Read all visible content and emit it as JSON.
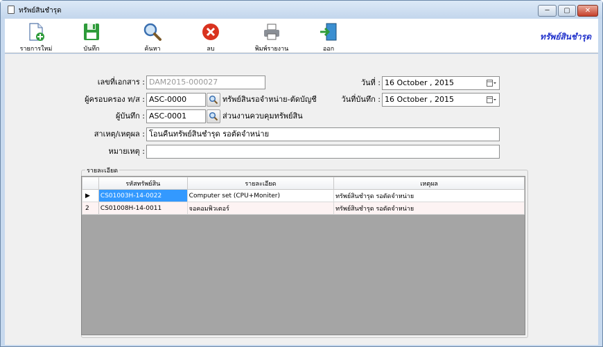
{
  "window": {
    "title": "ทรัพย์สินชำรุด",
    "min_label": "─",
    "max_label": "▢",
    "close_label": "✕"
  },
  "toolbar": {
    "new_label": "รายการใหม่",
    "save_label": "บันทึก",
    "search_label": "ค้นหา",
    "delete_label": "ลบ",
    "print_label": "พิมพ์รายงาน",
    "exit_label": "ออก",
    "brand": "ทรัพย์สินชำรุด"
  },
  "form": {
    "doc_no_label": "เลขที่เอกสาร :",
    "doc_no": "DAM2015-000027",
    "custodian_label": "ผู้ครอบครอง ท/ส :",
    "custodian_code": "ASC-0000",
    "custodian_name": "ทรัพย์สินรอจำหน่าย-ตัดบัญชี",
    "recorder_label": "ผู้บันทึก :",
    "recorder_code": "ASC-0001",
    "recorder_name": "ส่วนงานควบคุมทรัพย์สิน",
    "cause_label": "สาเหตุ/เหตุผล :",
    "cause": "โอนคืนทรัพย์สินชำรุด รอตัดจำหน่าย",
    "remark_label": "หมายเหตุ :",
    "remark": "",
    "date_label": "วันที่ :",
    "date_value": "16   October  , 2015",
    "record_date_label": "วันที่บันทึก :",
    "record_date_value": "16   October  , 2015"
  },
  "details": {
    "group_title": "รายละเอียด",
    "columns": [
      "รหัสทรัพย์สิน",
      "รายละเอียด",
      "เหตุผล"
    ],
    "rows": [
      {
        "marker": "▶",
        "code": "CS01003H-14-0022",
        "detail": "Computer set (CPU+Moniter)",
        "reason": "ทรัพย์สินชำรุด รอตัดจำหน่าย"
      },
      {
        "marker": "2",
        "code": "CS01008H-14-0011",
        "detail": "จอคอมพิวเตอร์",
        "reason": "ทรัพย์สินชำรุด รอตัดจำหน่าย"
      }
    ]
  },
  "icons": {
    "new": "new-document-icon",
    "save": "floppy-disk-icon",
    "search": "magnifier-icon",
    "delete": "red-x-icon",
    "print": "printer-icon",
    "exit": "exit-door-icon"
  }
}
